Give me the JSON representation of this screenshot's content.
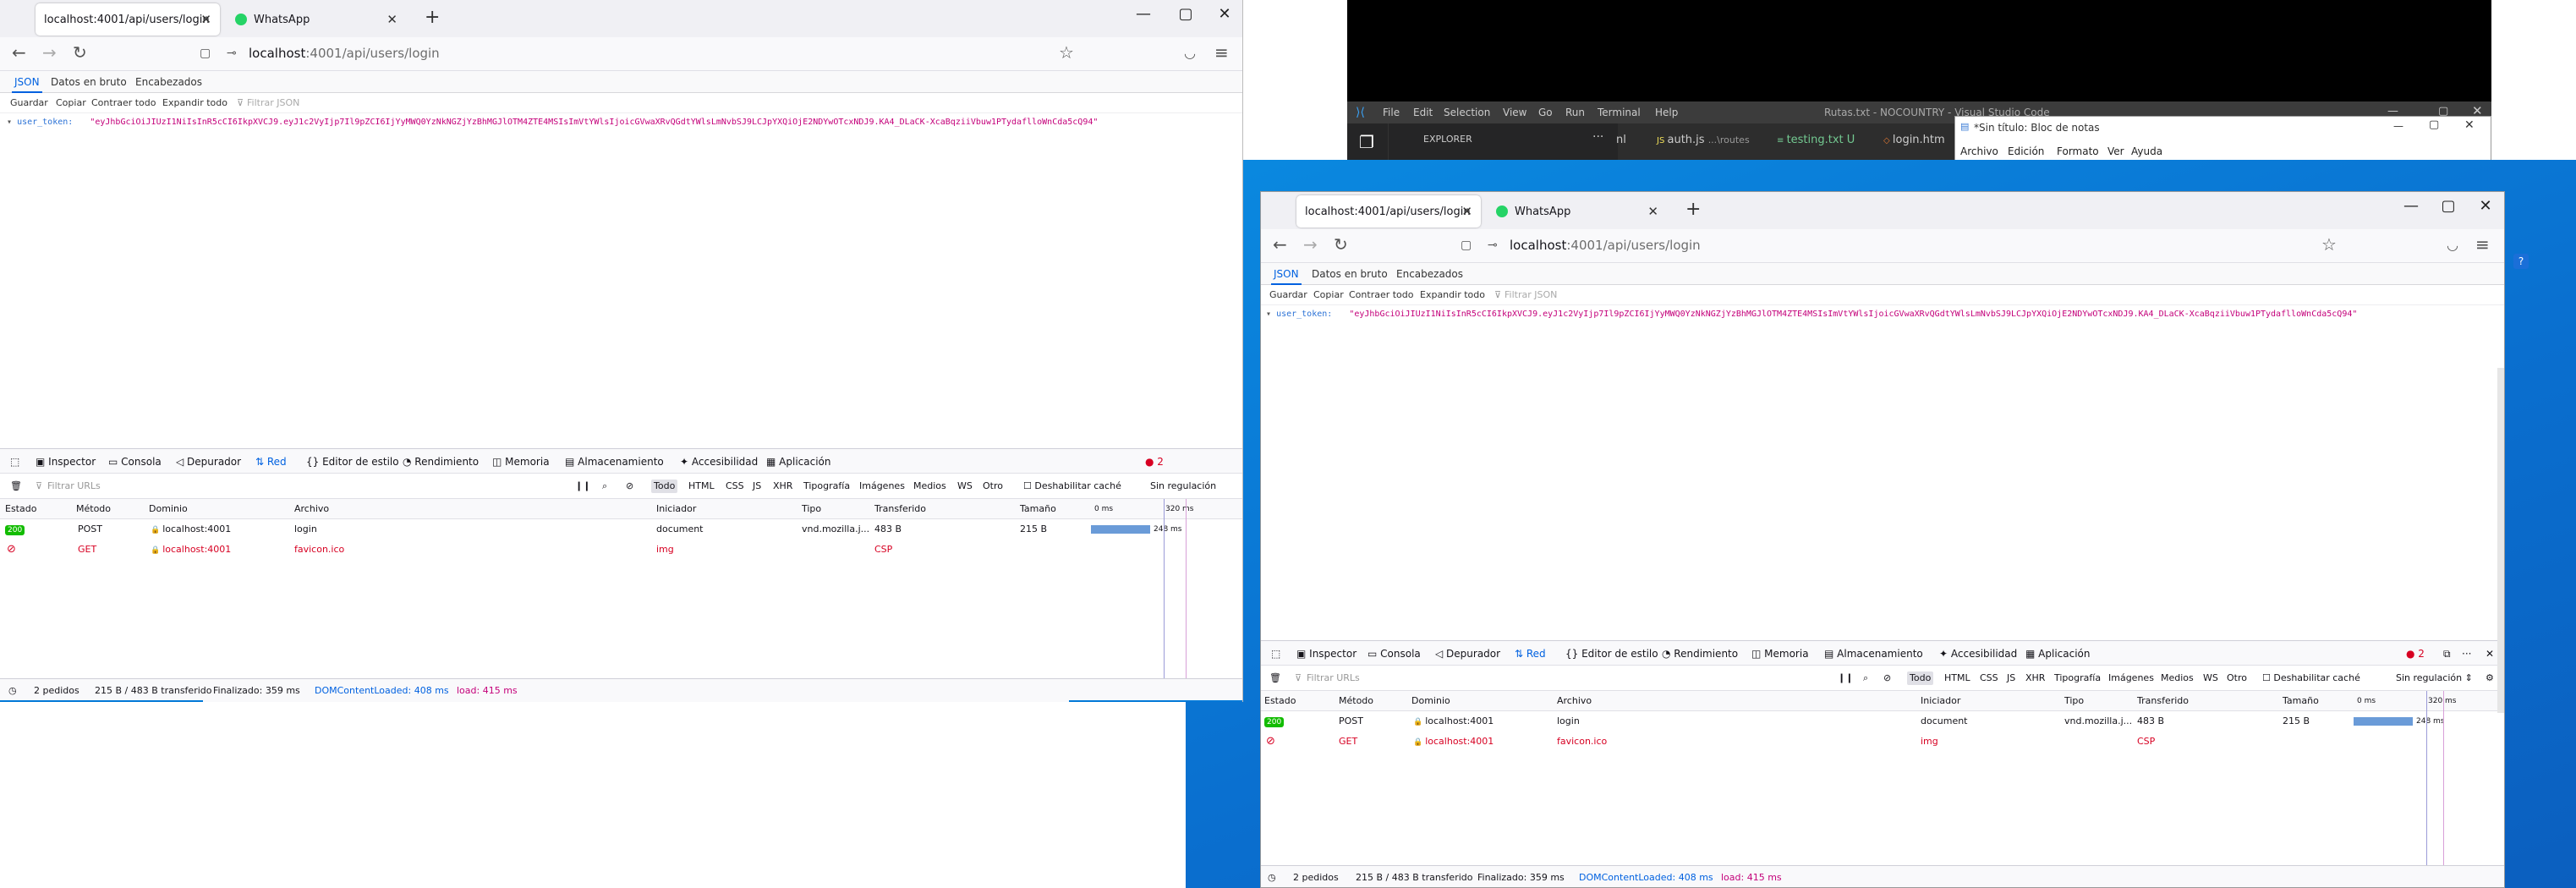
{
  "browser": {
    "tab_active": "localhost:4001/api/users/login",
    "tab_whatsapp": "WhatsApp",
    "url_host": "localhost",
    "url_path": ":4001/api/users/login",
    "view_tabs": [
      "JSON",
      "Datos en bruto",
      "Encabezados"
    ],
    "json_toolbar": [
      "Guardar",
      "Copiar",
      "Contraer todo",
      "Expandir todo"
    ],
    "json_filter_placeholder": "Filtrar JSON",
    "json_key": "user_token:",
    "json_value": "\"eyJhbGciOiJIUzI1NiIsInR5cCI6IkpXVCJ9.eyJ1c2VyIjp7Il9pZCI6IjYyMWQ0YzNkNGZjYzBhMGJlOTM4ZTE4MSIsImVtYWlsIjoicGVwaXRvQGdtYWlsLmNvbSJ9LCJpYXQiOjE2NDYwOTcxNDJ9.KA4_DLaCK-XcaBqziiVbuw1PTydaflloWnCda5cQ94\""
  },
  "devtools": {
    "tabs": [
      "Inspector",
      "Consola",
      "Depurador",
      "Red",
      "Editor de estilo",
      "Rendimiento",
      "Memoria",
      "Almacenamiento",
      "Accesibilidad",
      "Aplicación"
    ],
    "error_count": "2",
    "filter_placeholder": "Filtrar URLs",
    "types": [
      "Todo",
      "HTML",
      "CSS",
      "JS",
      "XHR",
      "Tipografía",
      "Imágenes",
      "Medios",
      "WS",
      "Otro"
    ],
    "disable_cache": "Deshabilitar caché",
    "throttle": "Sin regulación",
    "columns": [
      "Estado",
      "Método",
      "Dominio",
      "Archivo",
      "Iniciador",
      "Tipo",
      "Transferido",
      "Tamaño"
    ],
    "timeline_ticks": [
      "0 ms",
      "320 ms"
    ],
    "rows": [
      {
        "status": "200",
        "method": "POST",
        "domain": "localhost:4001",
        "file": "login",
        "initiator": "document",
        "type": "vnd.mozilla.j...",
        "transferred": "483 B",
        "size": "215 B",
        "time": "248 ms",
        "duration_ms": 248
      },
      {
        "status": "",
        "method": "GET",
        "domain": "localhost:4001",
        "file": "favicon.ico",
        "initiator": "img",
        "type": "",
        "transferred": "CSP",
        "size": "",
        "time": "",
        "duration_ms": 0
      }
    ],
    "status_bar": {
      "requests": "2 pedidos",
      "transferred": "215 B / 483 B transferido",
      "finished": "Finalizado: 359 ms",
      "dcl": "DOMContentLoaded: 408 ms",
      "load": "load: 415 ms"
    }
  },
  "vscode": {
    "menu": [
      "File",
      "Edit",
      "Selection",
      "View",
      "Go",
      "Run",
      "Terminal",
      "Help"
    ],
    "title": "Rutas.txt - NOCOUNTRY - Visual Studio Code",
    "explorer": "EXPLORER",
    "tabs": [
      "nl",
      "auth.js",
      "...\\routes",
      "testing.txt",
      "U",
      "login.htm"
    ]
  },
  "notepad": {
    "title": "*Sin título: Bloc de notas",
    "menu": [
      "Archivo",
      "Edición",
      "Formato",
      "Ver",
      "Ayuda"
    ]
  },
  "colors": {
    "accent": "#0061e0",
    "desktop": "#0a78d7",
    "json_string": "#c4007a",
    "error": "#d70022",
    "ok": "#12bc00"
  }
}
